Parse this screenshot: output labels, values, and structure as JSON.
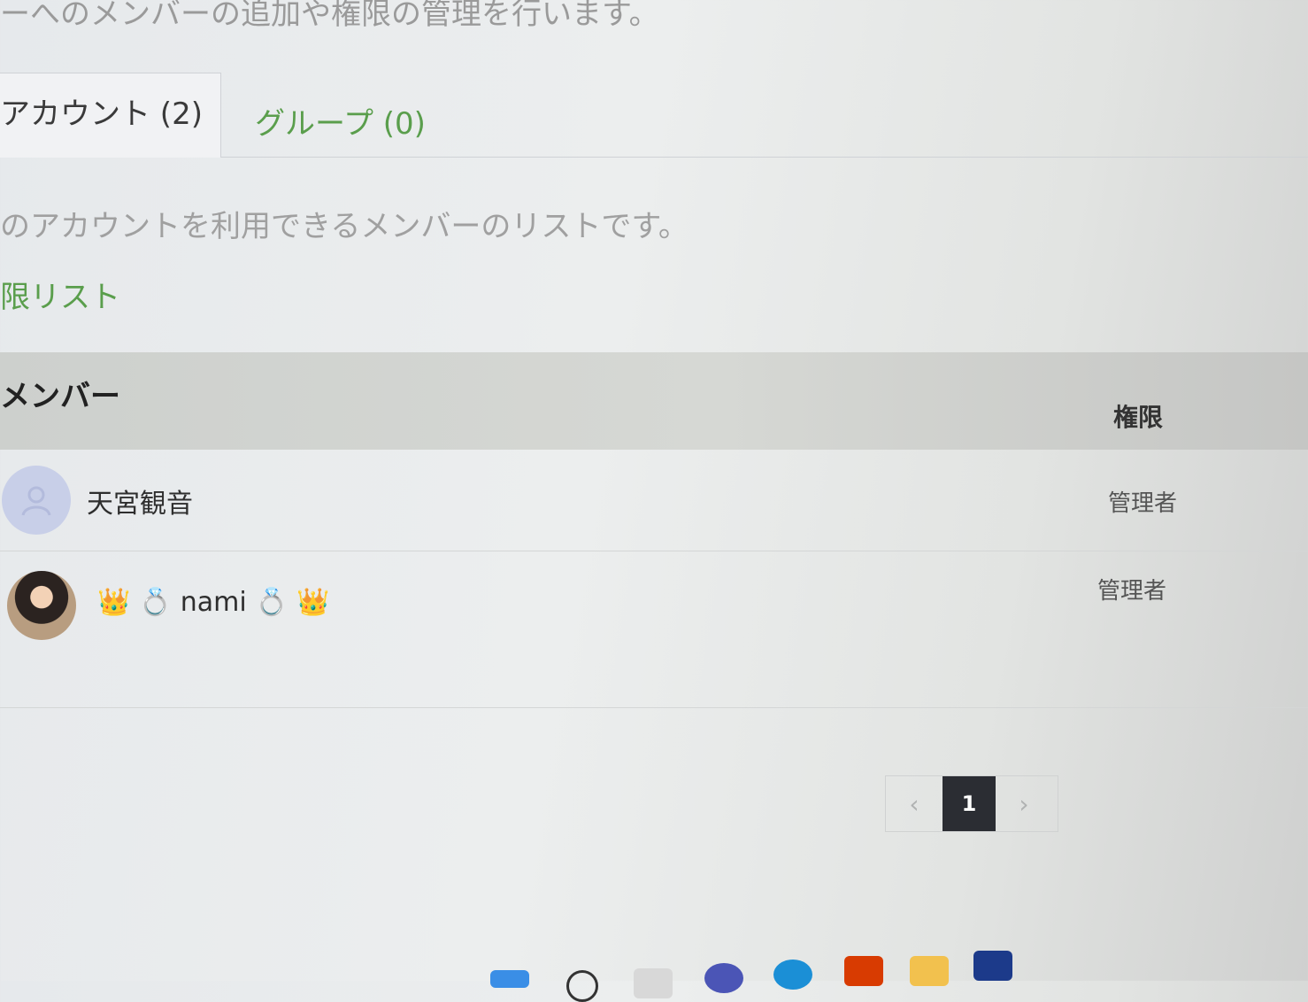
{
  "page": {
    "description": "ーへのメンバーの追加や権限の管理を行います。"
  },
  "tabs": [
    {
      "label": "アカウント (2)",
      "active": true
    },
    {
      "label": "グループ (0)",
      "active": false
    }
  ],
  "section": {
    "description": "のアカウントを利用できるメンバーのリストです。",
    "permission_link": "限リスト"
  },
  "table": {
    "headers": {
      "member": "メンバー",
      "role": "権限"
    },
    "rows": [
      {
        "name": "天宮観音",
        "role": "管理者",
        "avatar": "default-avatar"
      },
      {
        "name": "👑 💍 nami 💍 👑",
        "role": "管理者",
        "avatar": "photo-avatar"
      }
    ]
  },
  "pagination": {
    "prev": "‹",
    "current": "1",
    "next": "›"
  },
  "colors": {
    "accent_green": "#5a9e4c",
    "pagination_active": "#2b2d33"
  },
  "taskbar": {
    "icons": [
      "windows-start-icon",
      "search-icon",
      "task-view-icon",
      "teams-icon",
      "edge-icon",
      "office-icon",
      "file-explorer-icon",
      "amazon-music-icon"
    ]
  }
}
